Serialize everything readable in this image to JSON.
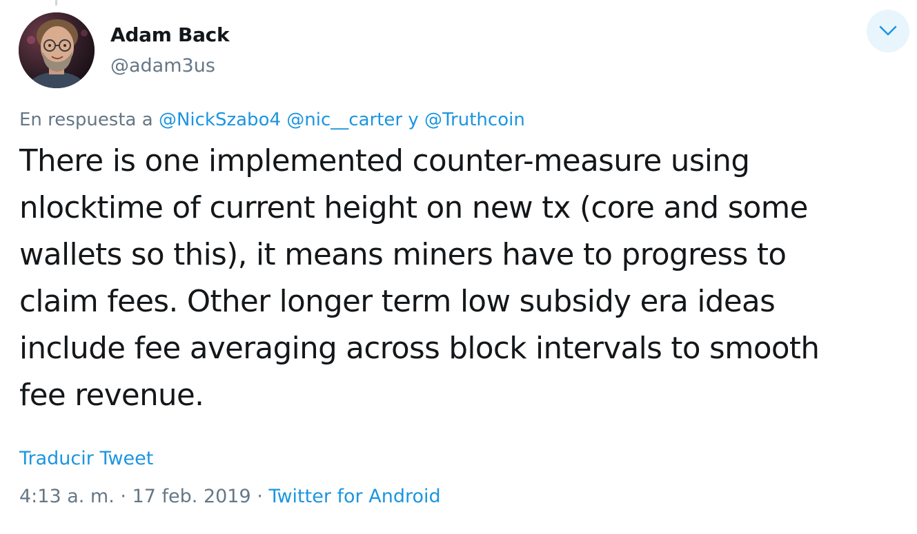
{
  "author": {
    "name": "Adam Back",
    "handle": "@adam3us"
  },
  "reply": {
    "prefix": "En respuesta a",
    "mention1": "@NickSzabo4",
    "mention2": "@nic__carter",
    "conjunction": "y",
    "mention3": "@Truthcoin"
  },
  "tweet": {
    "text": "There is one implemented counter-measure using\nnlocktime of current height on new tx (core and some\nwallets so this), it means miners have to progress to\nclaim fees. Other longer term low subsidy era ideas\ninclude fee averaging across block intervals to smooth\nfee revenue."
  },
  "actions": {
    "translate": "Traducir Tweet",
    "menu_icon": "chevron-down-icon"
  },
  "meta": {
    "time": "4:13 a. m.",
    "separator": "·",
    "date": "17 feb. 2019",
    "source": "Twitter for Android"
  },
  "colors": {
    "link": "#1b95e0",
    "secondary": "#657786",
    "primary_text": "#14171a",
    "caret_bg": "#e8f5fd"
  }
}
